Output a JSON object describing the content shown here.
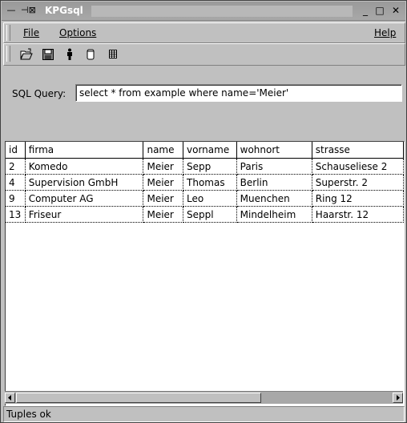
{
  "window": {
    "title": "KPGsql"
  },
  "menu": {
    "file": "File",
    "options": "Options",
    "help": "Help"
  },
  "toolbar": {
    "icons": [
      "open-folder-icon",
      "save-disk-icon",
      "person-icon",
      "database-icon",
      "table-grid-icon"
    ]
  },
  "query": {
    "label": "SQL Query:",
    "value": "select * from example where name='Meier'"
  },
  "table": {
    "columns": [
      "id",
      "firma",
      "name",
      "vorname",
      "wohnort",
      "strasse"
    ],
    "rows": [
      [
        "2",
        "Komedo",
        "Meier",
        "Sepp",
        "Paris",
        "Schauseliese 2"
      ],
      [
        "4",
        "Supervision GmbH",
        "Meier",
        "Thomas",
        "Berlin",
        "Superstr. 2"
      ],
      [
        "9",
        "Computer AG",
        "Meier",
        "Leo",
        "Muenchen",
        "Ring 12"
      ],
      [
        "13",
        "Friseur",
        "Meier",
        "Seppl",
        "Mindelheim",
        "Haarstr. 12"
      ]
    ]
  },
  "status": {
    "text": "Tuples ok"
  }
}
